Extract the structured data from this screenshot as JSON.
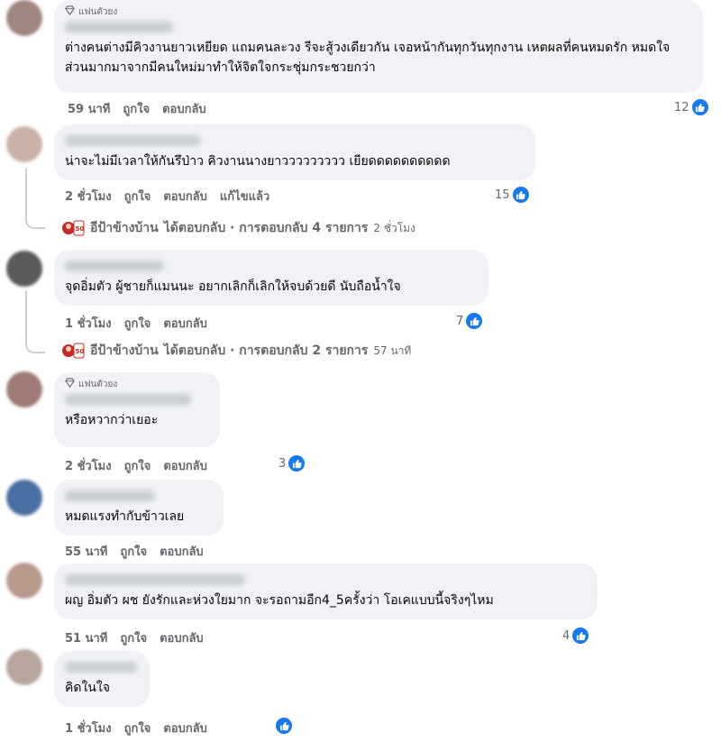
{
  "comments": [
    {
      "badge": "แฟนตัวยง",
      "text": "ต่างคนต่างมีคิวงานยาวเหยียด แถมคนละวง รีจะสู้วงเดียวกัน เจอหน้ากันทุกวันทุกงาน เหตผลที่คนหมดรัก หมดใจ ส่วนมากมาจากมีคนใหม่มาทำให้จิตใจกระชุ่มกระชวยกว่า",
      "time": "59 นาที",
      "like": "ถูกใจ",
      "reply": "ตอบกลับ",
      "reactions": "12"
    },
    {
      "text": "น่าจะไม่มีเวลาให้กันรึป่าว คิวงานนางยาววววววววว เยียดดดดดดดดดด",
      "time": "2 ชั่วโมง",
      "like": "ถูกใจ",
      "reply": "ตอบกลับ",
      "edited": "แก้ไขแล้ว",
      "reactions": "15",
      "reply_summary": {
        "author": "อีป้าข้างบ้าน",
        "text": "ได้ตอบกลับ · การตอบกลับ 4 รายการ",
        "time": "2 ชั่วโมง"
      }
    },
    {
      "text": "จุดอิ่มตัว ผู้ชายก็แมนนะ อยากเลิกก็เลิกให้จบด้วยดี นับถือน้ำใจ",
      "time": "1 ชั่วโมง",
      "like": "ถูกใจ",
      "reply": "ตอบกลับ",
      "reactions": "7",
      "reply_summary": {
        "author": "อีป้าข้างบ้าน",
        "text": "ได้ตอบกลับ · การตอบกลับ 2 รายการ",
        "time": "57 นาที"
      }
    },
    {
      "badge": "แฟนตัวยง",
      "text": "หรือหวากว่าเยอะ",
      "time": "2 ชั่วโมง",
      "like": "ถูกใจ",
      "reply": "ตอบกลับ",
      "reactions": "3"
    },
    {
      "text": "หมดแรงทำกับข้าวเลย",
      "time": "55 นาที",
      "like": "ถูกใจ",
      "reply": "ตอบกลับ"
    },
    {
      "text": "ผญ อิ่มตัว ผช ยังรักและห่วงใยมาก จะรอถามอีก4_5ครั้งว่า โอเคแบบนี้จริงๆไหม",
      "time": "51 นาที",
      "like": "ถูกใจ",
      "reply": "ตอบกลับ",
      "reactions": "4"
    },
    {
      "text": "คิดในใจ",
      "time": "1 ชั่วโมง",
      "like": "ถูกใจ",
      "reply": "ตอบกลับ"
    }
  ],
  "colors": {
    "bubble": "#f0f2f5",
    "like_blue": "#1877f2",
    "meta_gray": "#65676b"
  },
  "icons": [
    "diamond-badge-icon",
    "like-thumb-icon",
    "reply-avatar"
  ]
}
